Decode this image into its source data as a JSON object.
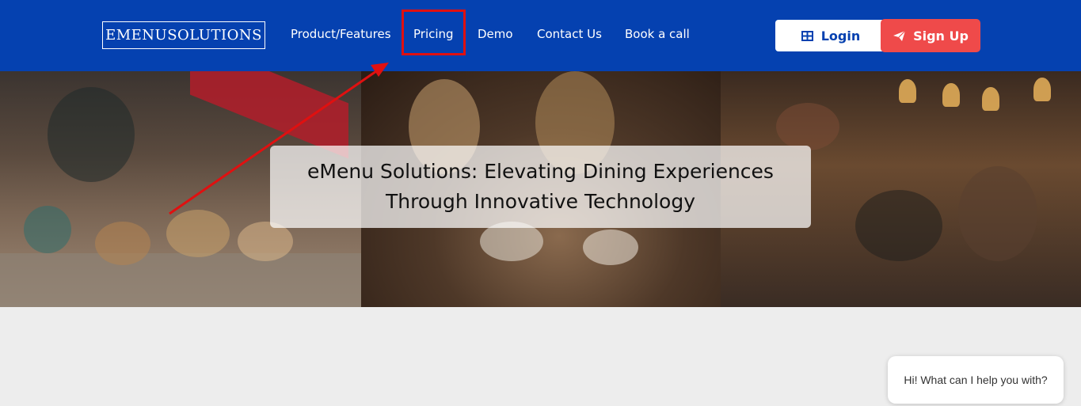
{
  "brand": {
    "logo_text": "EMENUSOLUTIONS"
  },
  "nav": {
    "items": [
      {
        "label": "Product/Features"
      },
      {
        "label": "Pricing"
      },
      {
        "label": "Demo"
      },
      {
        "label": "Contact Us"
      },
      {
        "label": "Book a call"
      }
    ],
    "highlighted_item": "Pricing"
  },
  "actions": {
    "login_label": "Login",
    "login_icon": "grid-icon",
    "signup_label": "Sign Up",
    "signup_icon": "paper-plane-icon"
  },
  "hero": {
    "line1": "eMenu Solutions: Elevating Dining Experiences",
    "line2": "Through Innovative Technology"
  },
  "chat": {
    "message": "Hi! What can I help you with?"
  },
  "colors": {
    "header_bg": "#0541b0",
    "signup_bg": "#ef4a4a",
    "annotation": "#e01010",
    "page_bg": "#ededed"
  }
}
